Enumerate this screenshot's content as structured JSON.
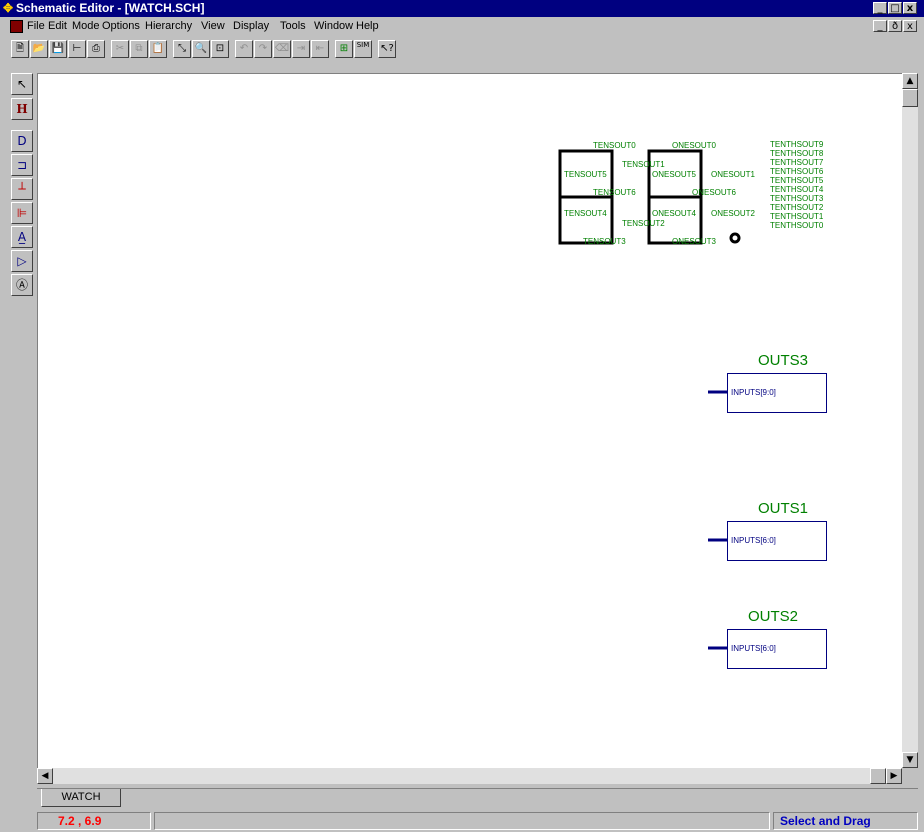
{
  "window": {
    "title": "Schematic Editor - [WATCH.SCH]",
    "buttons": [
      "_",
      "□",
      "x"
    ],
    "doc_buttons": [
      "_",
      "ð",
      "x"
    ]
  },
  "menu": [
    "File",
    "Edit",
    "Mode",
    "Options",
    "Hierarchy",
    "View",
    "Display",
    "Tools",
    "Window",
    "Help"
  ],
  "toolbar": {
    "sim_label": "SIM"
  },
  "left_tools": {
    "hier_label": "H"
  },
  "schematic": {
    "seg_left_labels": [
      "TENSOUT0",
      "TENSOUT1",
      "TENSOUT5",
      "TENSOUT6",
      "TENSOUT4",
      "TENSOUT2",
      "TENSOUT3"
    ],
    "seg_right_labels": [
      "ONESOUT0",
      "ONESOUT5",
      "ONESOUT1",
      "ONESOUT6",
      "ONESOUT4",
      "ONESOUT2",
      "ONESOUT3"
    ],
    "tenths_labels": [
      "TENTHSOUT9",
      "TENTHSOUT8",
      "TENTHSOUT7",
      "TENTHSOUT6",
      "TENTHSOUT5",
      "TENTHSOUT4",
      "TENTHSOUT3",
      "TENTHSOUT2",
      "TENTHSOUT1",
      "TENTHSOUT0"
    ],
    "blocks": [
      {
        "name": "OUTS3",
        "pin": "INPUTS[9:0]"
      },
      {
        "name": "OUTS1",
        "pin": "INPUTS[6:0]"
      },
      {
        "name": "OUTS2",
        "pin": "INPUTS[6:0]"
      }
    ]
  },
  "tab": {
    "label": "WATCH"
  },
  "status": {
    "coords": "7.2 ,   6.9",
    "mode": "Select and Drag"
  },
  "colors": {
    "title_bg": "#000080",
    "label_green": "#008000",
    "block_blue": "#000080",
    "coord_red": "#ff0000",
    "status_blue": "#0000c0"
  }
}
